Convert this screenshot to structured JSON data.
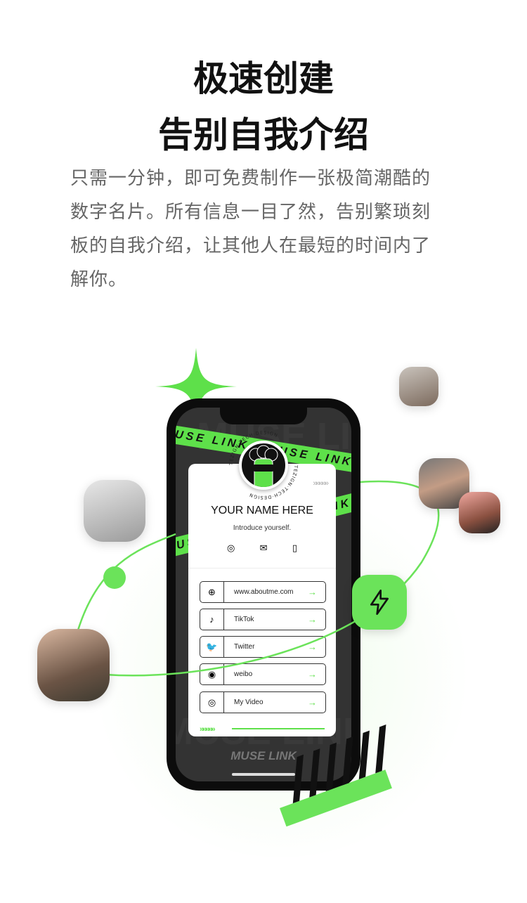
{
  "headline": {
    "line1": "极速创建",
    "line2": "告别自我介绍"
  },
  "description": [
    "只需一分钟，即可免费制作一张极简潮酷的",
    "数字名片。所有信息一目了然，告别繁琐刻",
    "板的自我介绍，让其他人在最短的时间内了",
    "解你。"
  ],
  "card": {
    "name": "YOUR NAME HERE",
    "intro": "Introduce yourself.",
    "contact_icons": [
      "wechat-icon",
      "mail-icon",
      "phone-icon"
    ],
    "links": [
      {
        "icon": "globe-icon",
        "glyph": "⊕",
        "label": "www.aboutme.com"
      },
      {
        "icon": "tiktok-icon",
        "glyph": "♪",
        "label": "TikTok"
      },
      {
        "icon": "twitter-icon",
        "glyph": "🐦",
        "label": "Twitter"
      },
      {
        "icon": "weibo-icon",
        "glyph": "◉",
        "label": "weibo"
      },
      {
        "icon": "video-icon",
        "glyph": "◎",
        "label": "My Video"
      }
    ],
    "arrow": "→",
    "chevrons": "»»»»»"
  },
  "bands": {
    "text": "MUSE LINK",
    "badge_text": "TEZIGN·TECH·DESIGN"
  },
  "brand": "MUSE LINK",
  "colors": {
    "accent": "#5ee04a",
    "phone": "#0c0c0c",
    "screen": "#333333"
  }
}
